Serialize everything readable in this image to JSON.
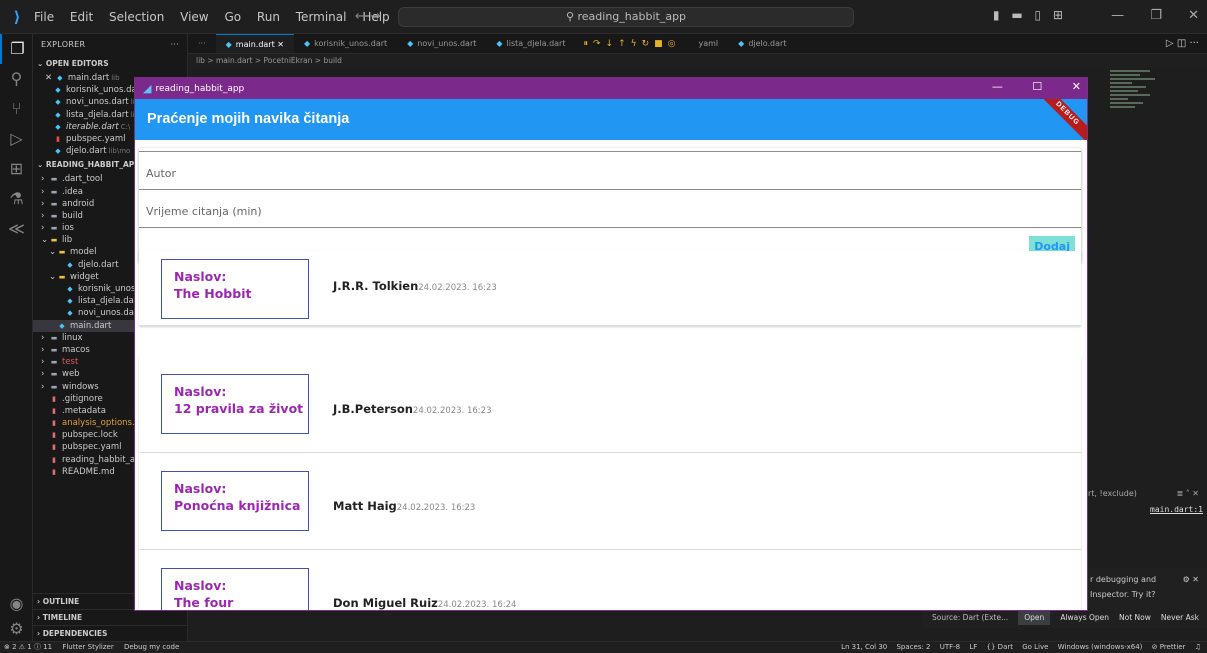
{
  "vscode": {
    "logo": "⟩",
    "menu": [
      "File",
      "Edit",
      "Selection",
      "View",
      "Go",
      "Run",
      "Terminal",
      "Help"
    ],
    "search_text": "reading_habbit_app",
    "tabs": [
      "main.dart",
      "korisnik_unos.dart",
      "novi_unos.dart",
      "lista_djela.dart",
      "yaml",
      "djelo.dart"
    ],
    "breadcrumb": "lib > main.dart > PocetniEkran > build",
    "explorer_title": "EXPLORER",
    "open_editors_title": "OPEN EDITORS",
    "open_editors": [
      {
        "name": "main.dart",
        "suffix": "lib"
      },
      {
        "name": "korisnik_unos.da",
        "suffix": ""
      },
      {
        "name": "novi_unos.dart",
        "suffix": "li"
      },
      {
        "name": "lista_djela.dart",
        "suffix": "li"
      },
      {
        "name": "iterable.dart",
        "suffix": "C:\\"
      },
      {
        "name": "pubspec.yaml",
        "suffix": ""
      },
      {
        "name": "djelo.dart",
        "suffix": "lib\\mo"
      }
    ],
    "project_title": "READING_HABBIT_APP",
    "tree": [
      {
        "name": ".dart_tool",
        "indent": 1,
        "type": "folder"
      },
      {
        "name": ".idea",
        "indent": 1,
        "type": "folder"
      },
      {
        "name": "android",
        "indent": 1,
        "type": "folder"
      },
      {
        "name": "build",
        "indent": 1,
        "type": "folder"
      },
      {
        "name": "ios",
        "indent": 1,
        "type": "folder"
      },
      {
        "name": "lib",
        "indent": 1,
        "type": "folder-open"
      },
      {
        "name": "model",
        "indent": 2,
        "type": "folder-open"
      },
      {
        "name": "djelo.dart",
        "indent": 3,
        "type": "dart"
      },
      {
        "name": "widget",
        "indent": 2,
        "type": "folder-open"
      },
      {
        "name": "korisnik_unos.d",
        "indent": 3,
        "type": "dart"
      },
      {
        "name": "lista_djela.dart",
        "indent": 3,
        "type": "dart"
      },
      {
        "name": "novi_unos.dart",
        "indent": 3,
        "type": "dart"
      },
      {
        "name": "main.dart",
        "indent": 2,
        "type": "dart",
        "selected": true
      },
      {
        "name": "linux",
        "indent": 1,
        "type": "folder"
      },
      {
        "name": "macos",
        "indent": 1,
        "type": "folder"
      },
      {
        "name": "test",
        "indent": 1,
        "type": "folder"
      },
      {
        "name": "web",
        "indent": 1,
        "type": "folder"
      },
      {
        "name": "windows",
        "indent": 1,
        "type": "folder"
      },
      {
        "name": ".gitignore",
        "indent": 1,
        "type": "file"
      },
      {
        "name": ".metadata",
        "indent": 1,
        "type": "file"
      },
      {
        "name": "analysis_options.y",
        "indent": 1,
        "type": "file"
      },
      {
        "name": "pubspec.lock",
        "indent": 1,
        "type": "file"
      },
      {
        "name": "pubspec.yaml",
        "indent": 1,
        "type": "file"
      },
      {
        "name": "reading_habbit_ap",
        "indent": 1,
        "type": "file"
      },
      {
        "name": "README.md",
        "indent": 1,
        "type": "file"
      }
    ],
    "outline_title": "OUTLINE",
    "timeline_title": "TIMELINE",
    "dependencies_title": "DEPENDENCIES",
    "panel_filter": "rt, !exclude)",
    "panel_link": "main.dart:1",
    "notification_text1": "r debugging and",
    "notification_text2": "Inspector. Try it?",
    "notification_source": "Source: Dart (Exte...",
    "notification_buttons": [
      "Open",
      "Always Open",
      "Not Now",
      "Never Ask"
    ],
    "status_left": [
      "⊗ 2 ⚠ 1 ⓘ 11",
      "Flutter Stylizer",
      "Debug my code"
    ],
    "status_right": [
      "Ln 31, Col 30",
      "Spaces: 2",
      "UTF-8",
      "LF",
      "{} Dart",
      "Go Live",
      "Windows (windows-x64)",
      "⊘ Prettier"
    ]
  },
  "app": {
    "window_title": "reading_habbit_app",
    "appbar_title": "Praćenje mojih navika čitanja",
    "debug_badge": "DEBUG",
    "fields": {
      "autor_placeholder": "Autor",
      "vrijeme_placeholder": "Vrijeme citanja (min)"
    },
    "add_button": "Dodaj",
    "books": [
      {
        "label": "Naslov:",
        "title": "The Hobbit",
        "author": "J.R.R. Tolkien",
        "date": "24.02.2023. 16:23"
      },
      {
        "label": "Naslov:",
        "title": "12 pravila za život",
        "author": "J.B.Peterson",
        "date": "24.02.2023. 16:23"
      },
      {
        "label": "Naslov:",
        "title": "Ponoćna knjižnica",
        "author": "Matt Haig",
        "date": "24.02.2023. 16:23"
      },
      {
        "label": "Naslov:",
        "title": "The four agreements",
        "author": "Don Miguel Ruiz",
        "date": "24.02.2023. 16:24"
      }
    ]
  }
}
